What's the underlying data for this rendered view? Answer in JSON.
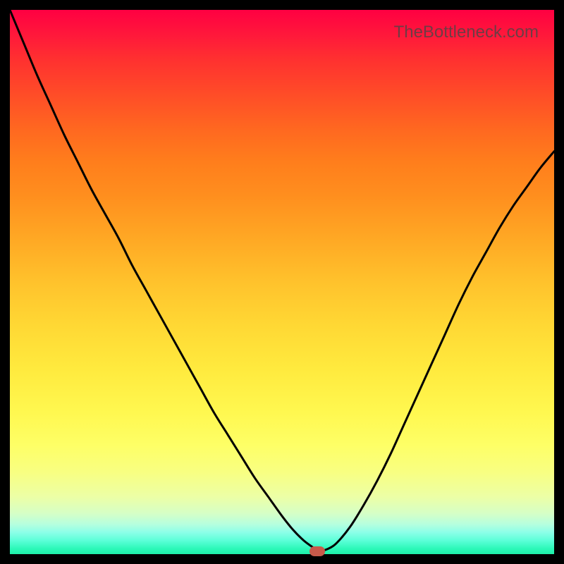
{
  "watermark": "TheBottleneck.com",
  "chart_data": {
    "type": "line",
    "title": "",
    "xlabel": "",
    "ylabel": "",
    "xlim": [
      0,
      100
    ],
    "ylim": [
      0,
      100
    ],
    "x": [
      0,
      2.5,
      5,
      7.5,
      10,
      12.5,
      15,
      17.5,
      20,
      22.5,
      25,
      27.5,
      30,
      32.5,
      35,
      37.5,
      40,
      42.5,
      45,
      47.5,
      50,
      52,
      54,
      56,
      56.5,
      57,
      58.5,
      60,
      62.5,
      65,
      67.5,
      70,
      72.5,
      75,
      77.5,
      80,
      82.5,
      85,
      87.5,
      90,
      92.5,
      95,
      97.5,
      100
    ],
    "values": [
      100,
      94,
      88,
      82.5,
      77,
      72,
      67,
      62.5,
      58,
      53,
      48.5,
      44,
      39.5,
      35,
      30.5,
      26,
      22,
      18,
      14,
      10.5,
      7,
      4.5,
      2.5,
      1,
      0.5,
      0.5,
      1,
      2,
      5,
      9,
      13.5,
      18.5,
      24,
      29.5,
      35,
      40.5,
      46,
      51,
      55.5,
      60,
      64,
      67.5,
      71,
      74
    ],
    "marker": {
      "x": 56.5,
      "y": 0.5
    },
    "gradient_colors": {
      "top": "#ff0042",
      "middle": "#ffea3e",
      "bottom": "#1ef0a8"
    },
    "frame_color": "#000000"
  }
}
